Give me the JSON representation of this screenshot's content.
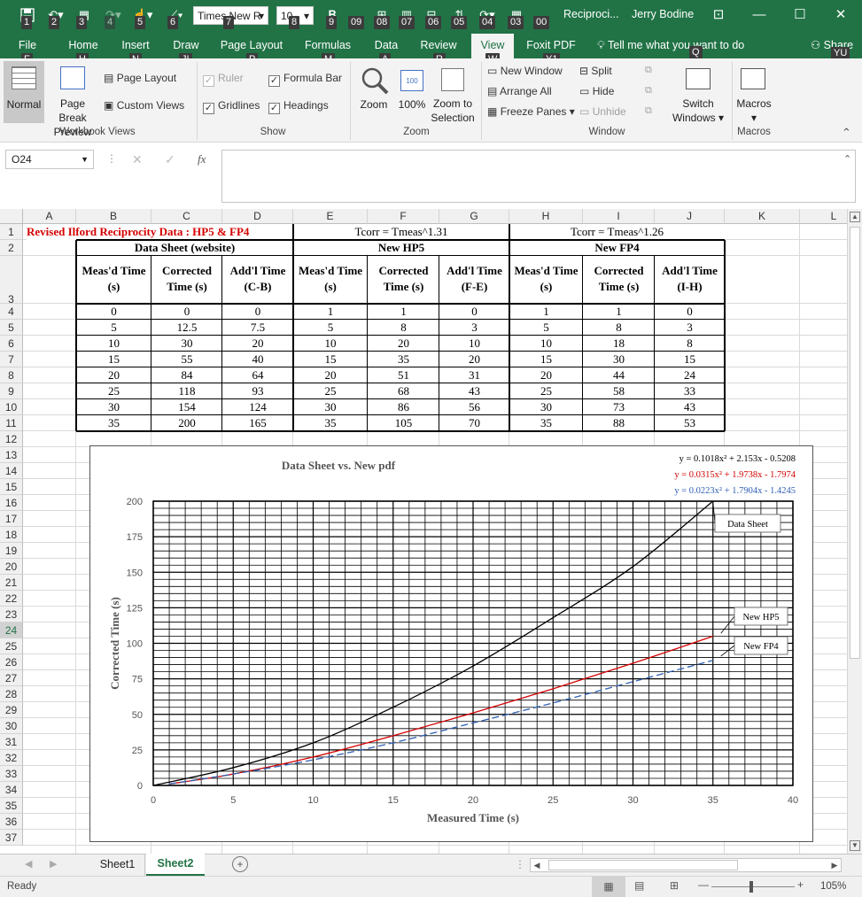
{
  "titlebar": {
    "font_name": "Times New R",
    "font_size": "10",
    "filename": "Reciproci...",
    "user": "Jerry Bodine",
    "keytips": [
      "1",
      "2",
      "3",
      "4",
      "5",
      "6",
      "7",
      "8",
      "9",
      "09",
      "08",
      "07",
      "06",
      "05",
      "04",
      "03",
      "00"
    ]
  },
  "tabs": {
    "items": [
      {
        "label": "File",
        "keytip": "F"
      },
      {
        "label": "Home",
        "keytip": "H"
      },
      {
        "label": "Insert",
        "keytip": "N"
      },
      {
        "label": "Draw",
        "keytip": "JI"
      },
      {
        "label": "Page Layout",
        "keytip": "P"
      },
      {
        "label": "Formulas",
        "keytip": "M"
      },
      {
        "label": "Data",
        "keytip": "A"
      },
      {
        "label": "Review",
        "keytip": "R"
      },
      {
        "label": "View",
        "keytip": "W"
      },
      {
        "label": "Foxit PDF",
        "keytip": "Y1"
      }
    ],
    "tell_me": "Tell me what you want to do",
    "tell_me_keytip": "Q",
    "share": "Share",
    "share_keytip": "YU"
  },
  "ribbon": {
    "workbook_views": {
      "label": "Workbook Views",
      "normal": "Normal",
      "page_break": "Page Break Preview",
      "page_layout": "Page Layout",
      "custom_views": "Custom Views"
    },
    "show": {
      "label": "Show",
      "ruler": "Ruler",
      "gridlines": "Gridlines",
      "formula_bar": "Formula Bar",
      "headings": "Headings"
    },
    "zoom": {
      "label": "Zoom",
      "zoom": "Zoom",
      "pct": "100%",
      "zoom_to_selection": "Zoom to Selection"
    },
    "window": {
      "label": "Window",
      "new_window": "New Window",
      "arrange_all": "Arrange All",
      "freeze_panes": "Freeze Panes",
      "split": "Split",
      "hide": "Hide",
      "unhide": "Unhide",
      "switch_windows": "Switch Windows"
    },
    "macros": {
      "label": "Macros",
      "macros": "Macros"
    }
  },
  "formula_bar": {
    "name_box": "O24",
    "fx": "fx",
    "value": ""
  },
  "columns": [
    "A",
    "B",
    "C",
    "D",
    "E",
    "F",
    "G",
    "H",
    "I",
    "J",
    "K",
    "L"
  ],
  "rows": [
    "1",
    "2",
    "3",
    "4",
    "5",
    "6",
    "7",
    "8",
    "9",
    "10",
    "11",
    "12",
    "13",
    "14",
    "15",
    "16",
    "17",
    "18",
    "19",
    "20",
    "21",
    "22",
    "23",
    "24",
    "25",
    "26",
    "27",
    "28",
    "29",
    "30",
    "31",
    "32",
    "33",
    "34",
    "35",
    "36",
    "37"
  ],
  "sheet": {
    "title": "Revised Ilford Reciprocity Data : HP5 & FP4",
    "hp5_formula": "Tcorr = Tmeas^1.31",
    "fp4_formula": "Tcorr = Tmeas^1.26",
    "group_datasheet": "Data Sheet (website)",
    "group_hp5": "New HP5",
    "group_fp4": "New FP4",
    "headers": [
      [
        "Meas'd Time",
        "(s)"
      ],
      [
        "Corrected",
        "Time (s)"
      ],
      [
        "Add'l Time",
        "(C-B)"
      ],
      [
        "Meas'd Time",
        "(s)"
      ],
      [
        "Corrected",
        "Time (s)"
      ],
      [
        "Add'l Time",
        "(F-E)"
      ],
      [
        "Meas'd Time",
        "(s)"
      ],
      [
        "Corrected",
        "Time (s)"
      ],
      [
        "Add'l Time",
        "(I-H)"
      ]
    ],
    "data": [
      [
        "0",
        "0",
        "0",
        "1",
        "1",
        "0",
        "1",
        "1",
        "0"
      ],
      [
        "5",
        "12.5",
        "7.5",
        "5",
        "8",
        "3",
        "5",
        "8",
        "3"
      ],
      [
        "10",
        "30",
        "20",
        "10",
        "20",
        "10",
        "10",
        "18",
        "8"
      ],
      [
        "15",
        "55",
        "40",
        "15",
        "35",
        "20",
        "15",
        "30",
        "15"
      ],
      [
        "20",
        "84",
        "64",
        "20",
        "51",
        "31",
        "20",
        "44",
        "24"
      ],
      [
        "25",
        "118",
        "93",
        "25",
        "68",
        "43",
        "25",
        "58",
        "33"
      ],
      [
        "30",
        "154",
        "124",
        "30",
        "86",
        "56",
        "30",
        "73",
        "43"
      ],
      [
        "35",
        "200",
        "165",
        "35",
        "105",
        "70",
        "35",
        "88",
        "53"
      ]
    ]
  },
  "chart_data": {
    "type": "line",
    "title": "Data Sheet vs. New pdf",
    "xlabel": "Measured Time (s)",
    "ylabel": "Corrected Time (s)",
    "xlim": [
      0,
      40
    ],
    "ylim": [
      0,
      200
    ],
    "xticks": [
      "0",
      "5",
      "10",
      "15",
      "20",
      "25",
      "30",
      "35",
      "40"
    ],
    "yticks": [
      "0",
      "25",
      "50",
      "75",
      "100",
      "125",
      "150",
      "175",
      "200"
    ],
    "grid": true,
    "series": [
      {
        "name": "Data Sheet",
        "color": "#000000",
        "dash": "solid",
        "x": [
          0,
          5,
          10,
          15,
          20,
          25,
          30,
          35
        ],
        "y": [
          0,
          12.5,
          30,
          55,
          84,
          118,
          154,
          200
        ]
      },
      {
        "name": "New HP5",
        "color": "#d40000",
        "dash": "solid",
        "x": [
          1,
          5,
          10,
          15,
          20,
          25,
          30,
          35
        ],
        "y": [
          1,
          8,
          20,
          35,
          51,
          68,
          86,
          105
        ]
      },
      {
        "name": "New FP4",
        "color": "#2e5fb4",
        "dash": "dashed",
        "x": [
          1,
          5,
          10,
          15,
          20,
          25,
          30,
          35
        ],
        "y": [
          1,
          8,
          18,
          30,
          44,
          58,
          73,
          88
        ]
      }
    ],
    "equations": [
      {
        "text": "y = 0.1018x² + 2.153x - 0.5208",
        "color": "#000000"
      },
      {
        "text": "y = 0.0315x² + 1.9738x - 1.7974",
        "color": "#d40000"
      },
      {
        "text": "y = 0.0223x² + 1.7904x - 1.4245",
        "color": "#2e5fb4"
      }
    ]
  },
  "sheet_tabs": [
    "Sheet1",
    "Sheet2"
  ],
  "active_sheet": "Sheet2",
  "status": {
    "ready": "Ready",
    "zoom": "105%"
  }
}
